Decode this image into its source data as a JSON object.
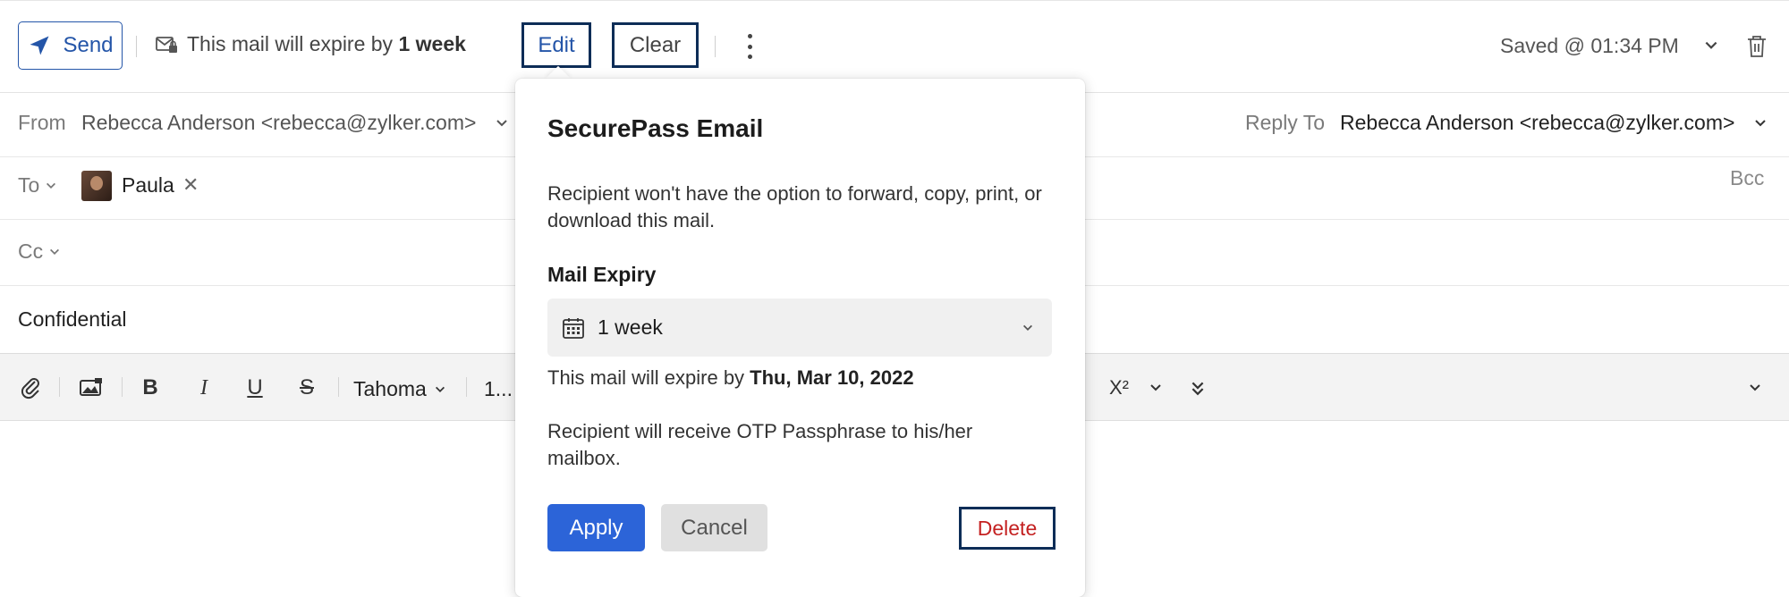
{
  "toolbar": {
    "send_label": "Send",
    "expiry_prefix": "This mail will expire by ",
    "expiry_value": "1 week",
    "edit_label": "Edit",
    "clear_label": "Clear",
    "saved_status": "Saved @ 01:34 PM"
  },
  "header": {
    "from_label": "From",
    "from_value": "Rebecca Anderson <rebecca@zylker.com>",
    "reply_to_label": "Reply To",
    "reply_to_value": "Rebecca Anderson <rebecca@zylker.com>",
    "to_label": "To",
    "to_recipient": "Paula",
    "bcc_label": "Bcc",
    "cc_label": "Cc",
    "subject": "Confidential"
  },
  "format_bar": {
    "font_name": "Tahoma",
    "font_size": "1...",
    "superscript": "X²"
  },
  "popup": {
    "title": "SecurePass Email",
    "description": "Recipient won't have the option to forward, copy, print, or download this mail.",
    "expiry_label": "Mail Expiry",
    "expiry_selected": "1 week",
    "expire_prefix": "This mail will expire by ",
    "expire_date": "Thu, Mar 10, 2022",
    "otp_note": "Recipient will receive OTP Passphrase to his/her mailbox.",
    "apply_label": "Apply",
    "cancel_label": "Cancel",
    "delete_label": "Delete"
  },
  "colors": {
    "accent_blue": "#2455a8",
    "apply_blue": "#2c64d8",
    "highlight_border": "#0d2d57",
    "delete_red": "#c42121"
  }
}
